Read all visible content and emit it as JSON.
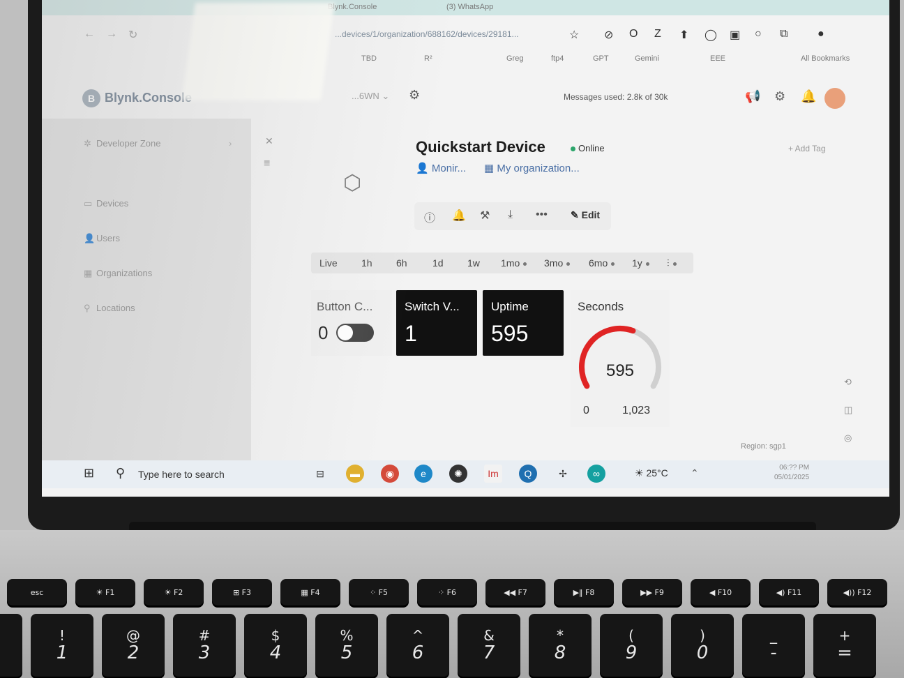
{
  "browser": {
    "tabs": [
      "Blynk.Console",
      "(3) WhatsApp"
    ],
    "url": "...devices/1/organization/688162/devices/29181...",
    "bookmarks": [
      "TBD",
      "R²",
      "Greg",
      "ftp4",
      "GPT",
      "Gemini",
      "EEE",
      "All Bookmarks"
    ]
  },
  "app": {
    "logo": "Blynk.Console",
    "org_selector": "...6WN",
    "messages_used": "Messages used: 2.8k of 30k"
  },
  "sidebar": {
    "items": [
      {
        "label": "Developer Zone",
        "icon": "code-icon"
      },
      {
        "label": "Devices",
        "icon": "devices-icon"
      },
      {
        "label": "Users",
        "icon": "user-icon"
      },
      {
        "label": "Organizations",
        "icon": "building-icon"
      },
      {
        "label": "Locations",
        "icon": "pin-icon"
      }
    ]
  },
  "device": {
    "title": "Quickstart Device",
    "status": "Online",
    "owner": "Monir...",
    "organization": "My organization...",
    "add_tag": "+ Add Tag",
    "edit_label": "Edit"
  },
  "ranges": [
    {
      "label": "Live",
      "dot": false
    },
    {
      "label": "1h",
      "dot": false
    },
    {
      "label": "6h",
      "dot": false
    },
    {
      "label": "1d",
      "dot": false
    },
    {
      "label": "1w",
      "dot": false
    },
    {
      "label": "1mo",
      "dot": true
    },
    {
      "label": "3mo",
      "dot": true
    },
    {
      "label": "6mo",
      "dot": true
    },
    {
      "label": "1y",
      "dot": true
    }
  ],
  "widgets": {
    "button": {
      "title": "Button C...",
      "value": "0",
      "on": false
    },
    "switch": {
      "title": "Switch V...",
      "value": "1"
    },
    "uptime": {
      "title": "Uptime",
      "value": "595"
    },
    "gauge": {
      "title": "Seconds",
      "value": 595,
      "display": "595",
      "min": "0",
      "max": "1,023",
      "min_value": 0,
      "max_value": 1023
    }
  },
  "footer": {
    "region": "Region: sgp1"
  },
  "taskbar": {
    "search_placeholder": "Type here to search",
    "weather": "25°C",
    "time": "06:?? PM",
    "date": "05/01/2025"
  },
  "colors": {
    "gauge_fill": "#e02424",
    "gauge_track": "#d0d0d0",
    "online": "#2ca56a"
  },
  "keyboard": {
    "fn_row": [
      {
        "top": "esc",
        "sub": ""
      },
      {
        "top": "☀",
        "sub": "F1"
      },
      {
        "top": "☀",
        "sub": "F2"
      },
      {
        "top": "⊞",
        "sub": "F3"
      },
      {
        "top": "▦",
        "sub": "F4"
      },
      {
        "top": "⁘",
        "sub": "F5"
      },
      {
        "top": "⁘",
        "sub": "F6"
      },
      {
        "top": "◀◀",
        "sub": "F7"
      },
      {
        "top": "▶‖",
        "sub": "F8"
      },
      {
        "top": "▶▶",
        "sub": "F9"
      },
      {
        "top": "◀",
        "sub": "F10"
      },
      {
        "top": "◀)",
        "sub": "F11"
      },
      {
        "top": "◀))",
        "sub": "F12"
      }
    ],
    "num_row": [
      {
        "top": "!",
        "bottom": "1"
      },
      {
        "top": "@",
        "bottom": "2"
      },
      {
        "top": "#",
        "bottom": "3"
      },
      {
        "top": "$",
        "bottom": "4"
      },
      {
        "top": "%",
        "bottom": "5"
      },
      {
        "top": "^",
        "bottom": "6"
      },
      {
        "top": "&",
        "bottom": "7"
      },
      {
        "top": "*",
        "bottom": "8"
      },
      {
        "top": "(",
        "bottom": "9"
      },
      {
        "top": ")",
        "bottom": "0"
      },
      {
        "top": "_",
        "bottom": "-"
      },
      {
        "top": "+",
        "bottom": "="
      }
    ]
  }
}
